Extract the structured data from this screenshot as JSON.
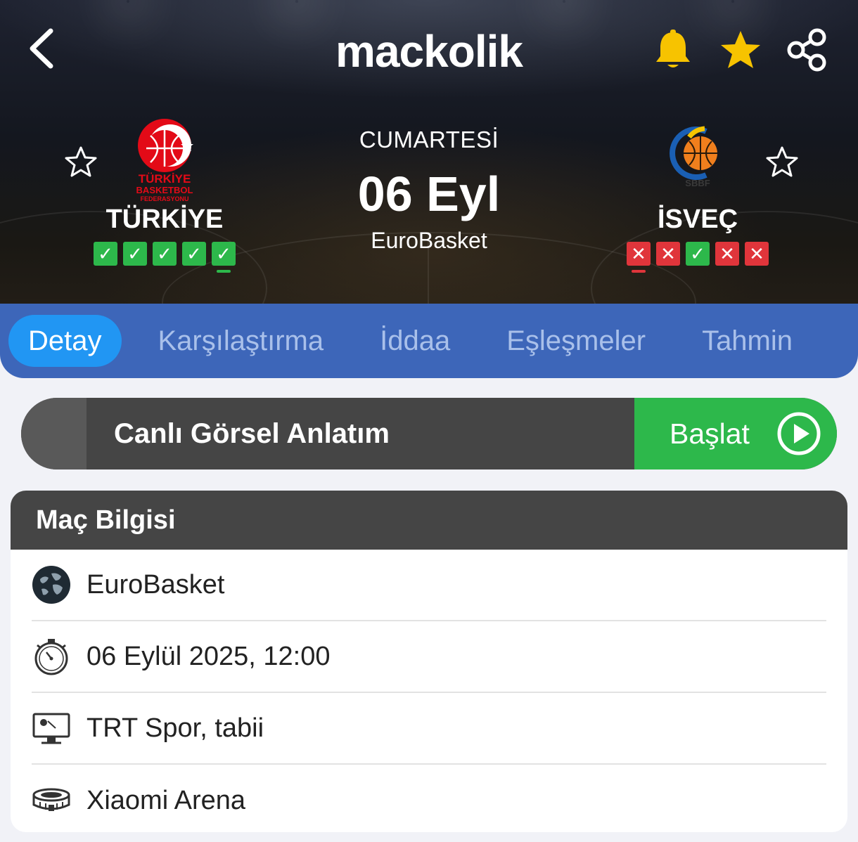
{
  "app": {
    "logo_text": "mackolik"
  },
  "header": {
    "icons": [
      "back-icon",
      "bell-icon",
      "star-icon",
      "share-icon"
    ],
    "colors": {
      "bell": "#f7c300",
      "star": "#f7c300"
    }
  },
  "match": {
    "day": "CUMARTESİ",
    "date": "06 Eyl",
    "league": "EuroBasket",
    "home": {
      "name": "TÜRKİYE",
      "logo_text": [
        "TÜRKİYE",
        "BASKETBOL",
        "FEDERASYONU"
      ],
      "form": [
        "W",
        "W",
        "W",
        "W",
        "W"
      ],
      "form_marks": [
        "✓",
        "✓",
        "✓",
        "✓",
        "✓"
      ]
    },
    "away": {
      "name": "İSVEÇ",
      "logo_text": "SBBF",
      "form": [
        "L",
        "L",
        "W",
        "L",
        "L"
      ],
      "form_marks": [
        "✕",
        "✕",
        "✓",
        "✕",
        "✕"
      ]
    }
  },
  "tabs": [
    {
      "label": "Detay",
      "active": true
    },
    {
      "label": "Karşılaştırma",
      "active": false
    },
    {
      "label": "İddaa",
      "active": false
    },
    {
      "label": "Eşleşmeler",
      "active": false
    },
    {
      "label": "Tahmin",
      "active": false
    }
  ],
  "live": {
    "label": "Canlı Görsel Anlatım",
    "button_label": "Başlat"
  },
  "info": {
    "title": "Maç Bilgisi",
    "rows": [
      {
        "icon": "globe-icon",
        "text": "EuroBasket"
      },
      {
        "icon": "stopwatch-icon",
        "text": "06 Eylül 2025, 12:00"
      },
      {
        "icon": "tv-icon",
        "text": "TRT Spor, tabii"
      },
      {
        "icon": "stadium-icon",
        "text": "Xiaomi Arena"
      }
    ]
  },
  "colors": {
    "tab_bar": "#3d66b9",
    "tab_active": "#2196f3",
    "win": "#2db84b",
    "loss": "#e0353b",
    "start_button": "#2db84b"
  }
}
